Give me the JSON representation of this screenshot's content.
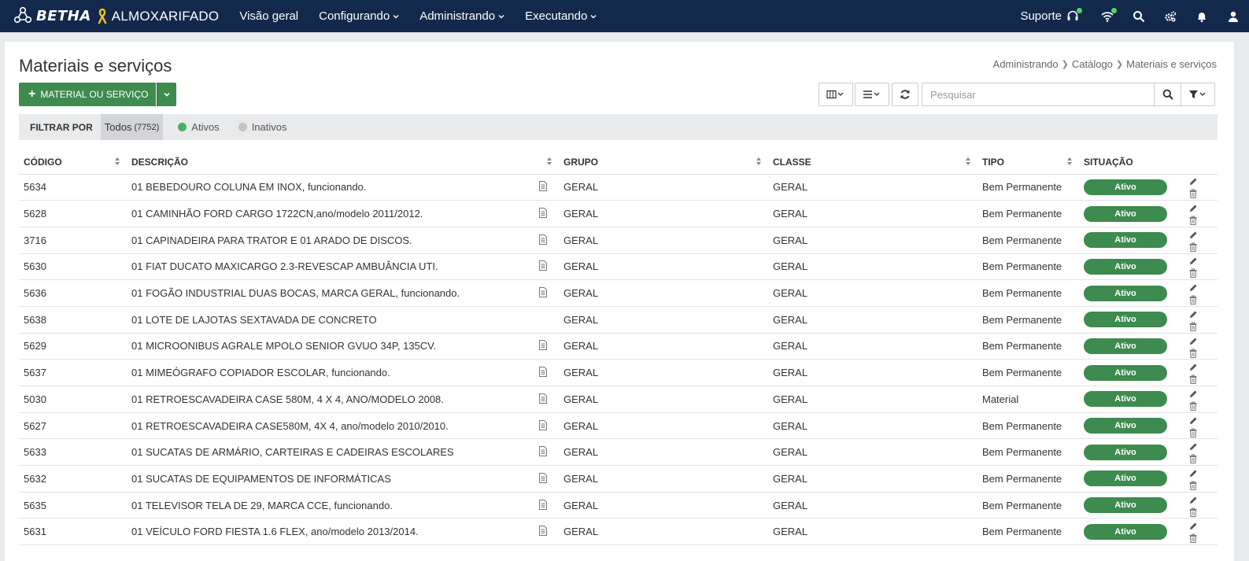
{
  "header": {
    "brand": "BETHA",
    "app_name": "ALMOXARIFADO",
    "nav": [
      {
        "label": "Visão geral",
        "dropdown": false
      },
      {
        "label": "Configurando",
        "dropdown": true
      },
      {
        "label": "Administrando",
        "dropdown": true
      },
      {
        "label": "Executando",
        "dropdown": true
      }
    ],
    "support_label": "Suporte"
  },
  "page": {
    "title": "Materiais e serviços",
    "breadcrumb": [
      "Administrando",
      "Catálogo",
      "Materiais e serviços"
    ],
    "add_button_label": "MATERIAL OU SERVIÇO",
    "search_placeholder": "Pesquisar"
  },
  "filter": {
    "label": "FILTRAR POR",
    "options": [
      {
        "label": "Todos",
        "count": "(7752)",
        "active": true,
        "color": ""
      },
      {
        "label": "Ativos",
        "count": "",
        "active": false,
        "color": "#4caf62"
      },
      {
        "label": "Inativos",
        "count": "",
        "active": false,
        "color": "#c4c4c4"
      }
    ]
  },
  "table": {
    "columns": [
      "CÓDIGO",
      "DESCRIÇÃO",
      "GRUPO",
      "CLASSE",
      "TIPO",
      "SITUAÇÃO"
    ],
    "rows": [
      {
        "codigo": "5634",
        "descricao": "01 BEBEDOURO COLUNA EM INOX, funcionando.",
        "has_doc": true,
        "grupo": "GERAL",
        "classe": "GERAL",
        "tipo": "Bem Permanente",
        "situacao": "Ativo"
      },
      {
        "codigo": "5628",
        "descricao": "01 CAMINHÃO FORD CARGO 1722CN,ano/modelo 2011/2012.",
        "has_doc": true,
        "grupo": "GERAL",
        "classe": "GERAL",
        "tipo": "Bem Permanente",
        "situacao": "Ativo"
      },
      {
        "codigo": "3716",
        "descricao": "01 CAPINADEIRA PARA TRATOR E 01 ARADO DE DISCOS.",
        "has_doc": true,
        "grupo": "GERAL",
        "classe": "GERAL",
        "tipo": "Bem Permanente",
        "situacao": "Ativo"
      },
      {
        "codigo": "5630",
        "descricao": "01 FIAT DUCATO MAXICARGO 2.3-REVESCAP AMBUÂNCIA UTI.",
        "has_doc": true,
        "grupo": "GERAL",
        "classe": "GERAL",
        "tipo": "Bem Permanente",
        "situacao": "Ativo"
      },
      {
        "codigo": "5636",
        "descricao": "01 FOGÃO INDUSTRIAL DUAS BOCAS, MARCA GERAL, funcionando.",
        "has_doc": true,
        "grupo": "GERAL",
        "classe": "GERAL",
        "tipo": "Bem Permanente",
        "situacao": "Ativo"
      },
      {
        "codigo": "5638",
        "descricao": "01 LOTE DE LAJOTAS SEXTAVADA DE CONCRETO",
        "has_doc": false,
        "grupo": "GERAL",
        "classe": "GERAL",
        "tipo": "Bem Permanente",
        "situacao": "Ativo"
      },
      {
        "codigo": "5629",
        "descricao": "01 MICROONIBUS AGRALE MPOLO SENIOR GVUO 34P, 135CV.",
        "has_doc": true,
        "grupo": "GERAL",
        "classe": "GERAL",
        "tipo": "Bem Permanente",
        "situacao": "Ativo"
      },
      {
        "codigo": "5637",
        "descricao": "01 MIMEÓGRAFO COPIADOR ESCOLAR, funcionando.",
        "has_doc": true,
        "grupo": "GERAL",
        "classe": "GERAL",
        "tipo": "Bem Permanente",
        "situacao": "Ativo"
      },
      {
        "codigo": "5030",
        "descricao": "01 RETROESCAVADEIRA CASE 580M, 4 X 4, ANO/MODELO 2008.",
        "has_doc": true,
        "grupo": "GERAL",
        "classe": "GERAL",
        "tipo": "Material",
        "situacao": "Ativo"
      },
      {
        "codigo": "5627",
        "descricao": "01 RETROESCAVADEIRA CASE580M, 4X 4, ano/modelo 2010/2010.",
        "has_doc": true,
        "grupo": "GERAL",
        "classe": "GERAL",
        "tipo": "Bem Permanente",
        "situacao": "Ativo"
      },
      {
        "codigo": "5633",
        "descricao": "01 SUCATAS DE ARMÁRIO, CARTEIRAS E CADEIRAS ESCOLARES",
        "has_doc": true,
        "grupo": "GERAL",
        "classe": "GERAL",
        "tipo": "Bem Permanente",
        "situacao": "Ativo"
      },
      {
        "codigo": "5632",
        "descricao": "01 SUCATAS DE EQUIPAMENTOS DE INFORMÁTICAS",
        "has_doc": true,
        "grupo": "GERAL",
        "classe": "GERAL",
        "tipo": "Bem Permanente",
        "situacao": "Ativo"
      },
      {
        "codigo": "5635",
        "descricao": "01 TELEVISOR TELA DE 29, MARCA CCE, funcionando.",
        "has_doc": true,
        "grupo": "GERAL",
        "classe": "GERAL",
        "tipo": "Bem Permanente",
        "situacao": "Ativo"
      },
      {
        "codigo": "5631",
        "descricao": "01 VEÍCULO FORD FIESTA 1.6 FLEX, ano/modelo 2013/2014.",
        "has_doc": true,
        "grupo": "GERAL",
        "classe": "GERAL",
        "tipo": "Bem Permanente",
        "situacao": "Ativo"
      }
    ]
  },
  "colors": {
    "header_bg": "#13294b",
    "accent_green": "#3d8b4f",
    "notification_dot": "#4cd964",
    "ribbon": "#f5c518"
  },
  "icons": [
    "betha-logo-icon",
    "ribbon-icon",
    "headset-icon",
    "wifi-icon",
    "search-icon",
    "gears-icon",
    "bell-icon",
    "user-icon",
    "columns-icon",
    "list-icon",
    "refresh-icon",
    "filter-icon",
    "document-icon",
    "pencil-icon",
    "trash-icon",
    "sort-icon"
  ]
}
